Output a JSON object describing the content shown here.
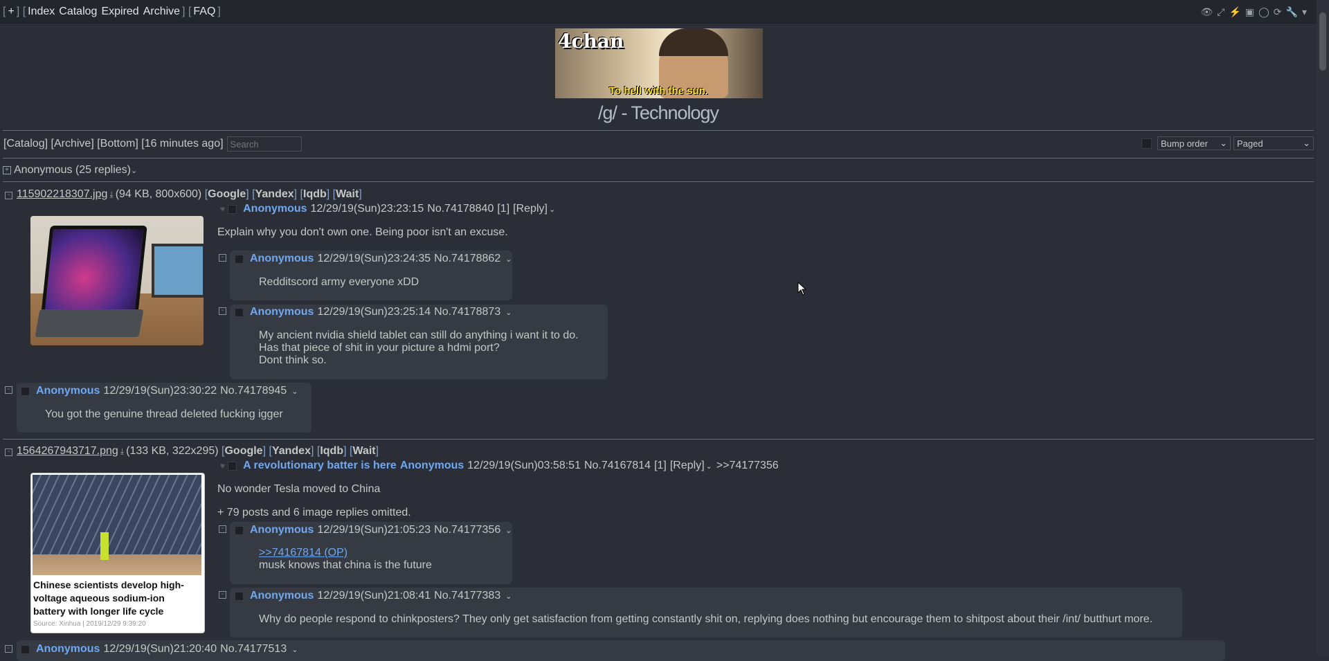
{
  "topbar": {
    "plus": "+",
    "links": [
      "Index",
      "Catalog",
      "Expired",
      "Archive"
    ],
    "faq": "FAQ"
  },
  "banner": {
    "logo": "4chan",
    "caption": "To hell with the sun."
  },
  "board_title": "/g/ - Technology",
  "nav": {
    "catalog": "Catalog",
    "archive": "Archive",
    "bottom": "Bottom",
    "updated": "16 minutes ago",
    "search_placeholder": "Search"
  },
  "sorting": {
    "order": "Bump order",
    "mode": "Paged"
  },
  "hidden_thread": {
    "label": "Anonymous (25 replies)"
  },
  "services": [
    "Google",
    "Yandex",
    "Iqdb",
    "Wait"
  ],
  "thread1": {
    "file_name": "115902218307.jpg",
    "file_meta": "(94 KB, 800x600)",
    "op": {
      "name": "Anonymous",
      "date": "12/29/19(Sun)23:23:15",
      "num": "No.74178840",
      "replies": "[1]",
      "reply_label": "[Reply]",
      "text": "Explain why you don't own one. Being poor isn't an excuse."
    },
    "replies": [
      {
        "name": "Anonymous",
        "date": "12/29/19(Sun)23:24:35",
        "num": "No.74178862",
        "lines": [
          "Redditscord army everyone xDD"
        ]
      },
      {
        "name": "Anonymous",
        "date": "12/29/19(Sun)23:25:14",
        "num": "No.74178873",
        "lines": [
          "My ancient nvidia shield tablet can still do anything i want it to do.",
          "Has that piece of shit in your picture a hdmi port?",
          "Dont think so."
        ]
      },
      {
        "name": "Anonymous",
        "date": "12/29/19(Sun)23:30:22",
        "num": "No.74178945",
        "lines": [
          "You got the genuine thread deleted fucking igger"
        ]
      }
    ]
  },
  "thread2": {
    "file_name": "1564267943717.png",
    "file_meta": "(133 KB, 322x295)",
    "thumb_caption": "Chinese scientists develop high-voltage aqueous sodium-ion battery with longer life cycle",
    "thumb_source": "Source: Xinhua | 2019/12/29 9:39:20",
    "op": {
      "subject": "A revolutionary batter is here",
      "name": "Anonymous",
      "date": "12/29/19(Sun)03:58:51",
      "num": "No.74167814",
      "replies": "[1]",
      "reply_label": "[Reply]",
      "backlink": ">>74177356",
      "text": "No wonder Tesla moved to China"
    },
    "omitted": "+ 79 posts and 6 image replies omitted.",
    "replies": [
      {
        "name": "Anonymous",
        "date": "12/29/19(Sun)21:05:23",
        "num": "No.74177356",
        "quote": ">>74167814 (OP)",
        "lines": [
          "musk knows that china is the future"
        ]
      },
      {
        "name": "Anonymous",
        "date": "12/29/19(Sun)21:08:41",
        "num": "No.74177383",
        "lines": [
          "Why do people respond to chinkposters? They only get satisfaction from getting constantly shit on, replying does nothing but encourage them to shitpost about their /int/ butthurt more."
        ]
      },
      {
        "name": "Anonymous",
        "date": "12/29/19(Sun)21:20:40",
        "num": "No.74177513",
        "lines": []
      }
    ]
  }
}
